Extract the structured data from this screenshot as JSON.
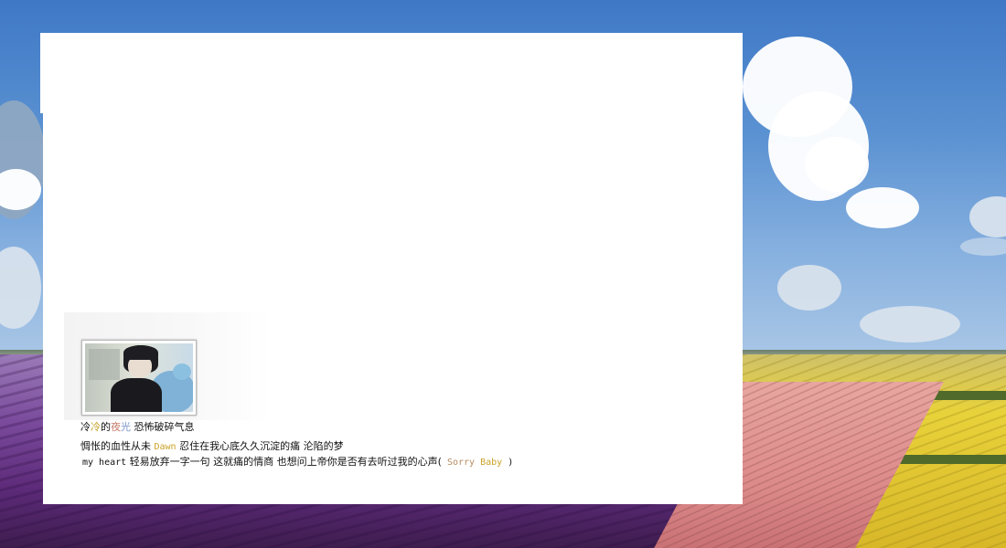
{
  "profile": {
    "signature": [
      {
        "text": "冷",
        "color": "#111111"
      },
      {
        "text": "冷",
        "color": "#c9a227"
      },
      {
        "text": "的",
        "color": "#111111"
      },
      {
        "text": "夜",
        "color": "#c77a6a"
      },
      {
        "text": "光",
        "color": "#7b95c9"
      },
      {
        "text": " 恐怖破碎气息",
        "color": "#111111"
      }
    ],
    "bio_line1_a": "惆怅的血性从未 ",
    "bio_line1_highlight": "Dawn",
    "bio_line1_b": " 忍住在我心底久久沉淀的痛  沦陷的梦",
    "bio_line2_a": "my heart",
    "bio_line2_b": " 轻易放弃一字一句 这就痛的情商 也想问上帝你是否有去听过我的心声(",
    "bio_line2_highlight1": " Sorry ",
    "bio_line2_highlight2": "Baby",
    "bio_line2_end": " )"
  },
  "colors": {
    "panel": "#ffffff",
    "accent_gold": "#c9a227",
    "accent_tan": "#b78b60"
  },
  "icons": {
    "avatar": "user-photo"
  }
}
